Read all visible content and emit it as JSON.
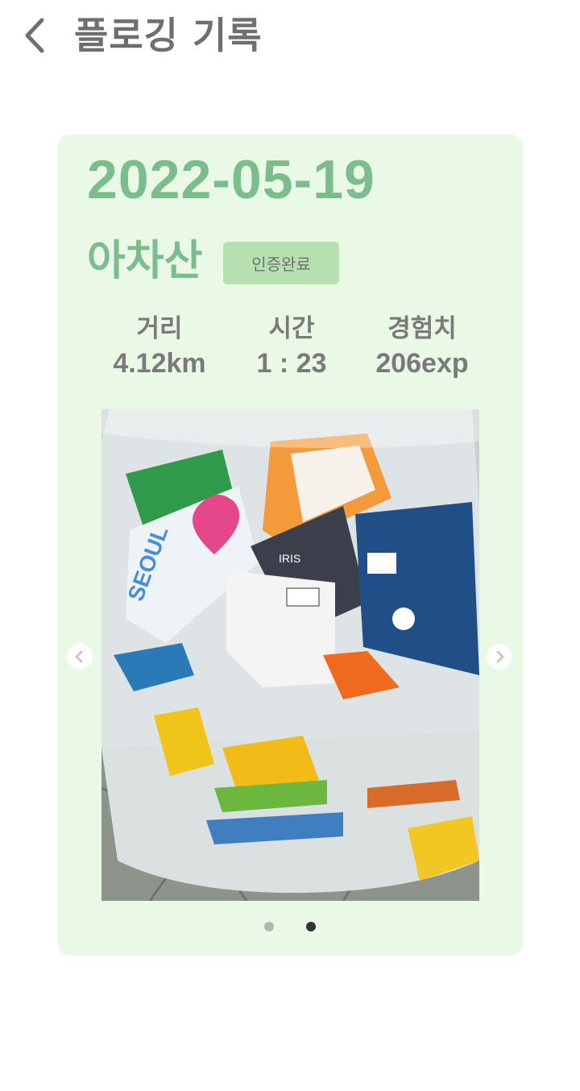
{
  "header": {
    "title": "플로깅 기록",
    "back_icon": "chevron-left-icon"
  },
  "record": {
    "date": "2022-05-19",
    "place": "아차산",
    "badge": "인증완료",
    "stats": [
      {
        "label": "거리",
        "value": "4.12km"
      },
      {
        "label": "시간",
        "value": "1 : 23"
      },
      {
        "label": "경험치",
        "value": "206exp"
      }
    ]
  },
  "carousel": {
    "photo_description": "trash-bag-photo",
    "prev_icon": "chevron-left-circle-icon",
    "next_icon": "chevron-right-circle-icon",
    "page_count": 2,
    "active_index": 1
  },
  "colors": {
    "card_bg": "#eaf8e6",
    "accent_green": "#7cbd8e",
    "badge_bg": "#b6e0b0",
    "text_gray": "#7a7a7a",
    "dot_active": "#333333",
    "dot_inactive": "#b5b5b5"
  }
}
